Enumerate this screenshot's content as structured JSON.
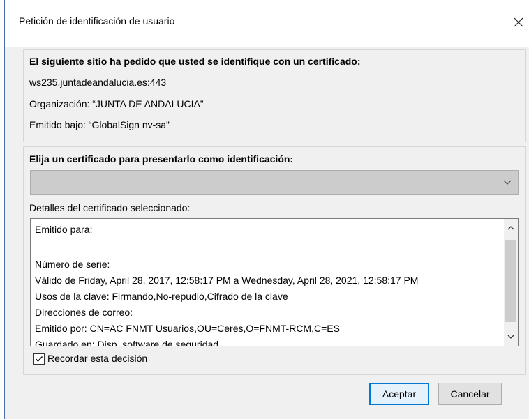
{
  "dialog": {
    "title": "Petición de identificación de usuario"
  },
  "site_group": {
    "heading": "El siguiente sitio ha pedido que usted se identifique con un certificado:",
    "host": "ws235.juntadeandalucia.es:443",
    "organization": "Organización: “JUNTA DE ANDALUCIA”",
    "issued_under": "Emitido bajo: “GlobalSign nv-sa”"
  },
  "cert_group": {
    "heading": "Elija un certificado para presentarlo como identificación:",
    "selected_value": "",
    "details_label": "Detalles del certificado seleccionado:",
    "details_lines": [
      "Emitido para:",
      "",
      "Número de serie:",
      "Válido de Friday, April 28, 2017, 12:58:17 PM a Wednesday, April 28, 2021, 12:58:17 PM",
      "Usos de la clave: Firmando,No-repudio,Cifrado de la clave",
      "Direcciones de correo:",
      "Emitido por: CN=AC FNMT Usuarios,OU=Ceres,O=FNMT-RCM,C=ES",
      "Guardado en: Disp. software de seguridad"
    ],
    "remember_label": "Recordar esta decisión",
    "remember_checked": true
  },
  "buttons": {
    "accept": "Aceptar",
    "cancel": "Cancelar"
  },
  "colors": {
    "accent": "#0078d7",
    "window_border": "#4a6ea8"
  },
  "icons": {
    "close": "close-icon",
    "dropdown": "chevron-down-icon",
    "scroll_up": "chevron-up-icon",
    "scroll_down": "chevron-down-icon",
    "checkbox": "checkmark-icon"
  }
}
